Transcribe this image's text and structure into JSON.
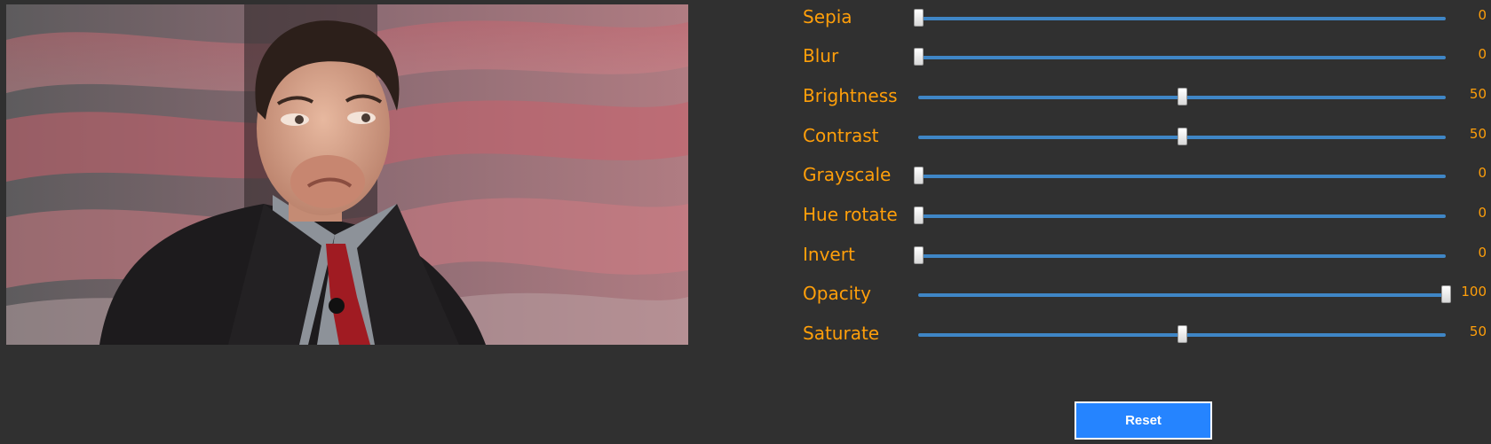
{
  "preview": {
    "icon": "photo-preview",
    "alt": ""
  },
  "filters": [
    {
      "label": "Sepia",
      "value": "0",
      "min": 0,
      "max": 100,
      "level": 0
    },
    {
      "label": "Blur",
      "value": "0",
      "min": 0,
      "max": 100,
      "level": 0
    },
    {
      "label": "Brightness",
      "value": "50",
      "min": 0,
      "max": 100,
      "level": 50
    },
    {
      "label": "Contrast",
      "value": "50",
      "min": 0,
      "max": 100,
      "level": 50
    },
    {
      "label": "Grayscale",
      "value": "0",
      "min": 0,
      "max": 100,
      "level": 0
    },
    {
      "label": "Hue rotate",
      "value": "0",
      "min": 0,
      "max": 100,
      "level": 0
    },
    {
      "label": "Invert",
      "value": "0",
      "min": 0,
      "max": 100,
      "level": 0
    },
    {
      "label": "Opacity",
      "value": "100",
      "min": 0,
      "max": 100,
      "level": 100
    },
    {
      "label": "Saturate",
      "value": "50",
      "min": 0,
      "max": 100,
      "level": 50
    }
  ],
  "reset": {
    "label": "Reset"
  },
  "colors": {
    "background": "#303030",
    "label": "#ff9f0a",
    "track": "#3f86c6",
    "button": "#2584ff"
  }
}
